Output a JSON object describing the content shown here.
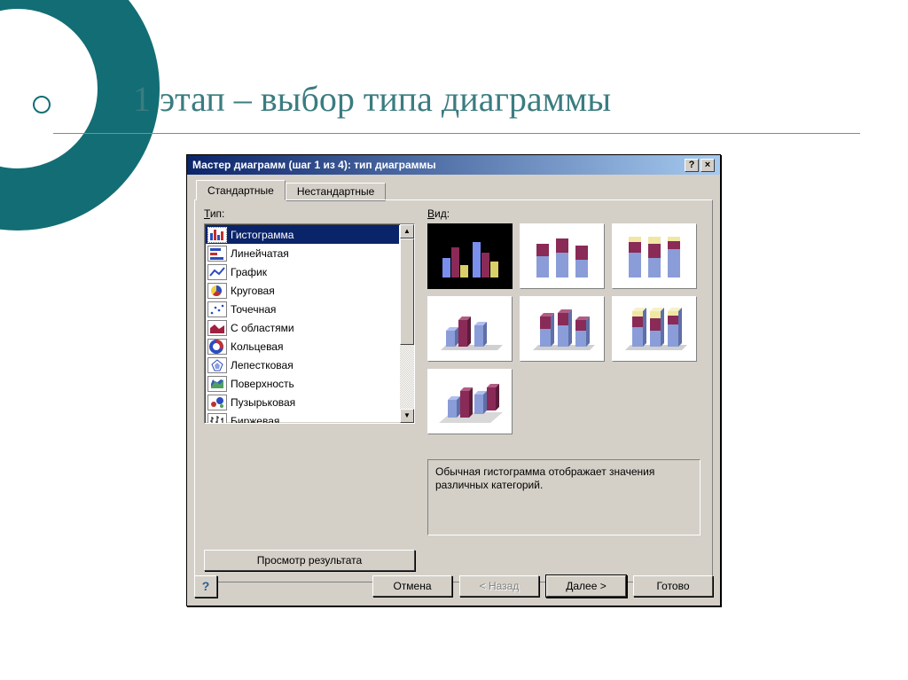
{
  "slide": {
    "title": "1 этап – выбор типа диаграммы"
  },
  "dialog": {
    "title": "Мастер диаграмм (шаг 1 из 4): тип диаграммы",
    "help_hint": "?",
    "close_hint": "×",
    "tabs": {
      "standard": "Стандартные",
      "custom": "Нестандартные"
    },
    "labels": {
      "type_pre": "Т",
      "type_rest": "ип:",
      "view_pre": "В",
      "view_rest": "ид:"
    },
    "chart_types": [
      {
        "name": "Гистограмма",
        "icon": "bar"
      },
      {
        "name": "Линейчатая",
        "icon": "hbar"
      },
      {
        "name": "График",
        "icon": "line"
      },
      {
        "name": "Круговая",
        "icon": "pie"
      },
      {
        "name": "Точечная",
        "icon": "scatter"
      },
      {
        "name": "С областями",
        "icon": "area"
      },
      {
        "name": "Кольцевая",
        "icon": "donut"
      },
      {
        "name": "Лепестковая",
        "icon": "radar"
      },
      {
        "name": "Поверхность",
        "icon": "surface"
      },
      {
        "name": "Пузырьковая",
        "icon": "bubble"
      },
      {
        "name": "Биржевая",
        "icon": "stock"
      }
    ],
    "selected_type_index": 0,
    "description": "Обычная гистограмма отображает значения различных категорий.",
    "preview_button": "Просмотр результата",
    "buttons": {
      "cancel": "Отмена",
      "back": "< Назад",
      "next": "Далее >",
      "finish": "Готово"
    }
  }
}
